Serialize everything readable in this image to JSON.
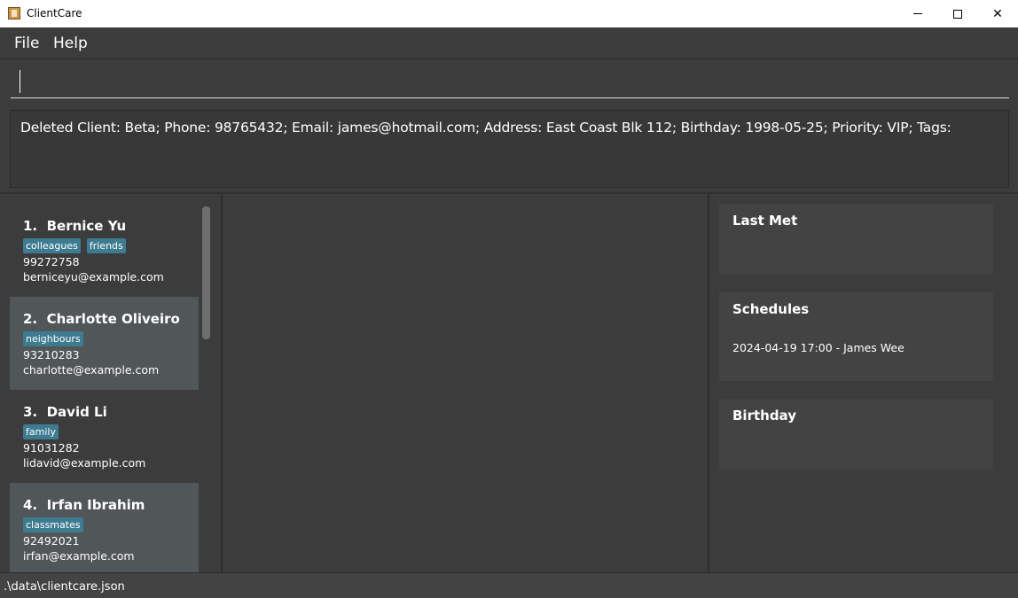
{
  "window": {
    "title": "ClientCare",
    "controls": {
      "minimize": "",
      "maximize": "",
      "close": "✕"
    }
  },
  "menu": {
    "items": [
      "File",
      "Help"
    ]
  },
  "command": {
    "value": "",
    "placeholder": ""
  },
  "result": {
    "text": "Deleted Client: Beta; Phone: 98765432; Email: james@hotmail.com; Address: East Coast Blk 112; Birthday: 1998-05-25; Priority: VIP; Tags:"
  },
  "clients": [
    {
      "index": "1.",
      "name": "Bernice Yu",
      "tags": [
        "colleagues",
        "friends"
      ],
      "phone": "99272758",
      "email": "berniceyu@example.com"
    },
    {
      "index": "2.",
      "name": "Charlotte Oliveiro",
      "tags": [
        "neighbours"
      ],
      "phone": "93210283",
      "email": "charlotte@example.com"
    },
    {
      "index": "3.",
      "name": "David Li",
      "tags": [
        "family"
      ],
      "phone": "91031282",
      "email": "lidavid@example.com"
    },
    {
      "index": "4.",
      "name": "Irfan Ibrahim",
      "tags": [
        "classmates"
      ],
      "phone": "92492021",
      "email": "irfan@example.com"
    }
  ],
  "panels": {
    "last_met": {
      "title": "Last Met",
      "body": ""
    },
    "schedules": {
      "title": "Schedules",
      "body": "2024-04-19 17:00 - James Wee"
    },
    "birthday": {
      "title": "Birthday",
      "body": ""
    }
  },
  "status": {
    "path": ".\\data\\clientcare.json"
  },
  "colors": {
    "background": "#3c3c3c",
    "card_alt": "#515658",
    "tag": "#3e7b91",
    "panel": "#434343"
  },
  "icons": [
    "app-icon",
    "minimize-icon",
    "maximize-icon",
    "close-icon"
  ]
}
